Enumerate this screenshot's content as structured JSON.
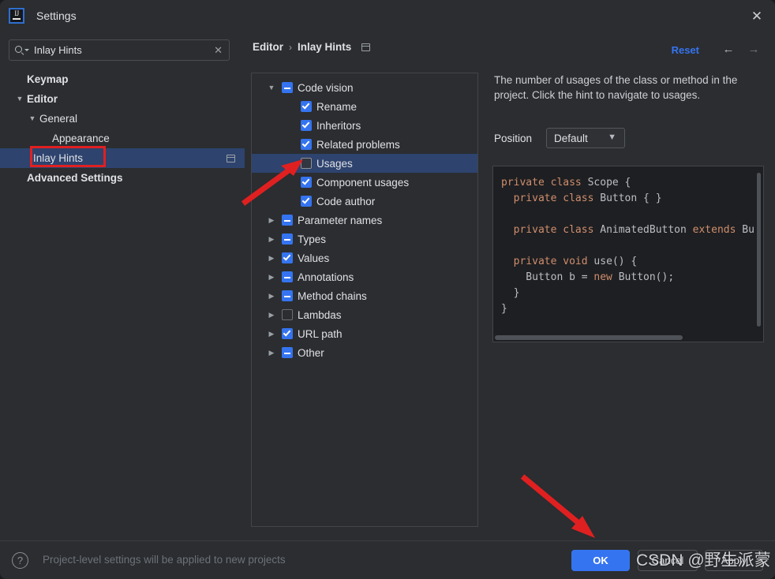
{
  "window": {
    "title": "Settings",
    "app_icon": "intellij-idea-logo",
    "close_icon": "close-icon"
  },
  "search": {
    "value": "Inlay Hints",
    "placeholder": "Search settings",
    "icon": "search-icon",
    "clear_icon": "clear-icon"
  },
  "sidebar": {
    "items": [
      {
        "label": "Keymap",
        "indent": 0,
        "bold": true,
        "arrow": "",
        "selected": false,
        "trailing_icon": false
      },
      {
        "label": "Editor",
        "indent": 0,
        "bold": true,
        "arrow": "v",
        "selected": false,
        "trailing_icon": false
      },
      {
        "label": "General",
        "indent": 1,
        "bold": false,
        "arrow": "v",
        "selected": false,
        "trailing_icon": false
      },
      {
        "label": "Appearance",
        "indent": 2,
        "bold": false,
        "arrow": "",
        "selected": false,
        "trailing_icon": false
      },
      {
        "label": "Inlay Hints",
        "indent": 2,
        "bold": false,
        "arrow": "",
        "selected": true,
        "trailing_icon": true
      },
      {
        "label": "Advanced Settings",
        "indent": 0,
        "bold": true,
        "arrow": "",
        "selected": false,
        "trailing_icon": false
      }
    ]
  },
  "breadcrumb": {
    "parent": "Editor",
    "separator": "›",
    "current": "Inlay Hints",
    "copy_icon": "copy-settings-path-icon"
  },
  "header": {
    "reset_label": "Reset",
    "back_icon": "←",
    "forward_icon": "→"
  },
  "tree": {
    "rows": [
      {
        "label": "Code vision",
        "indent": 0,
        "arrow": "v",
        "checkbox": "partial",
        "selected": false
      },
      {
        "label": "Rename",
        "indent": 1,
        "arrow": "",
        "checkbox": "checked",
        "selected": false
      },
      {
        "label": "Inheritors",
        "indent": 1,
        "arrow": "",
        "checkbox": "checked",
        "selected": false
      },
      {
        "label": "Related problems",
        "indent": 1,
        "arrow": "",
        "checkbox": "checked",
        "selected": false
      },
      {
        "label": "Usages",
        "indent": 1,
        "arrow": "",
        "checkbox": "empty",
        "selected": true
      },
      {
        "label": "Component usages",
        "indent": 1,
        "arrow": "",
        "checkbox": "checked",
        "selected": false
      },
      {
        "label": "Code author",
        "indent": 1,
        "arrow": "",
        "checkbox": "checked",
        "selected": false
      },
      {
        "label": "Parameter names",
        "indent": 0,
        "arrow": ">",
        "checkbox": "partial",
        "selected": false
      },
      {
        "label": "Types",
        "indent": 0,
        "arrow": ">",
        "checkbox": "partial",
        "selected": false
      },
      {
        "label": "Values",
        "indent": 0,
        "arrow": ">",
        "checkbox": "checked",
        "selected": false
      },
      {
        "label": "Annotations",
        "indent": 0,
        "arrow": ">",
        "checkbox": "partial",
        "selected": false
      },
      {
        "label": "Method chains",
        "indent": 0,
        "arrow": ">",
        "checkbox": "partial",
        "selected": false
      },
      {
        "label": "Lambdas",
        "indent": 0,
        "arrow": ">",
        "checkbox": "empty",
        "selected": false
      },
      {
        "label": "URL path",
        "indent": 0,
        "arrow": ">",
        "checkbox": "checked",
        "selected": false
      },
      {
        "label": "Other",
        "indent": 0,
        "arrow": ">",
        "checkbox": "partial",
        "selected": false
      }
    ]
  },
  "details": {
    "description": "The number of usages of the class or method in the project. Click the hint to navigate to usages.",
    "position_label": "Position",
    "position_value": "Default",
    "position_chevron": "chevron-down-icon",
    "code_lines": [
      [
        {
          "t": "private",
          "k": true
        },
        {
          "t": " ",
          "k": false
        },
        {
          "t": "class",
          "k": true
        },
        {
          "t": " Scope {",
          "k": false
        }
      ],
      [
        {
          "t": "  ",
          "k": false
        },
        {
          "t": "private",
          "k": true
        },
        {
          "t": " ",
          "k": false
        },
        {
          "t": "class",
          "k": true
        },
        {
          "t": " Button { }",
          "k": false
        }
      ],
      [
        {
          "t": "",
          "k": false
        }
      ],
      [
        {
          "t": "  ",
          "k": false
        },
        {
          "t": "private",
          "k": true
        },
        {
          "t": " ",
          "k": false
        },
        {
          "t": "class",
          "k": true
        },
        {
          "t": " AnimatedButton ",
          "k": false
        },
        {
          "t": "extends",
          "k": true
        },
        {
          "t": " Bu",
          "k": false
        }
      ],
      [
        {
          "t": "",
          "k": false
        }
      ],
      [
        {
          "t": "  ",
          "k": false
        },
        {
          "t": "private",
          "k": true
        },
        {
          "t": " ",
          "k": false
        },
        {
          "t": "void",
          "k": true
        },
        {
          "t": " use() {",
          "k": false
        }
      ],
      [
        {
          "t": "    Button b = ",
          "k": false
        },
        {
          "t": "new",
          "k": true
        },
        {
          "t": " Button();",
          "k": false
        }
      ],
      [
        {
          "t": "  }",
          "k": false
        }
      ],
      [
        {
          "t": "}",
          "k": false
        }
      ]
    ]
  },
  "footer": {
    "help_icon": "help-icon",
    "note": "Project-level settings will be applied to new projects",
    "ok_label": "OK",
    "cancel_label": "Cancel",
    "apply_label": "Apply"
  },
  "annotations": {
    "watermark": "CSDN @野生派蒙",
    "arrow_color": "#e02020",
    "highlight_box_color": "#e02020"
  },
  "colors": {
    "accent": "#3574f0",
    "dialog_bg": "#2b2d30",
    "selection": "#2e436e",
    "code_bg": "#1e1f22",
    "keyword": "#cf8e6d",
    "text": "#dfe1e5"
  }
}
